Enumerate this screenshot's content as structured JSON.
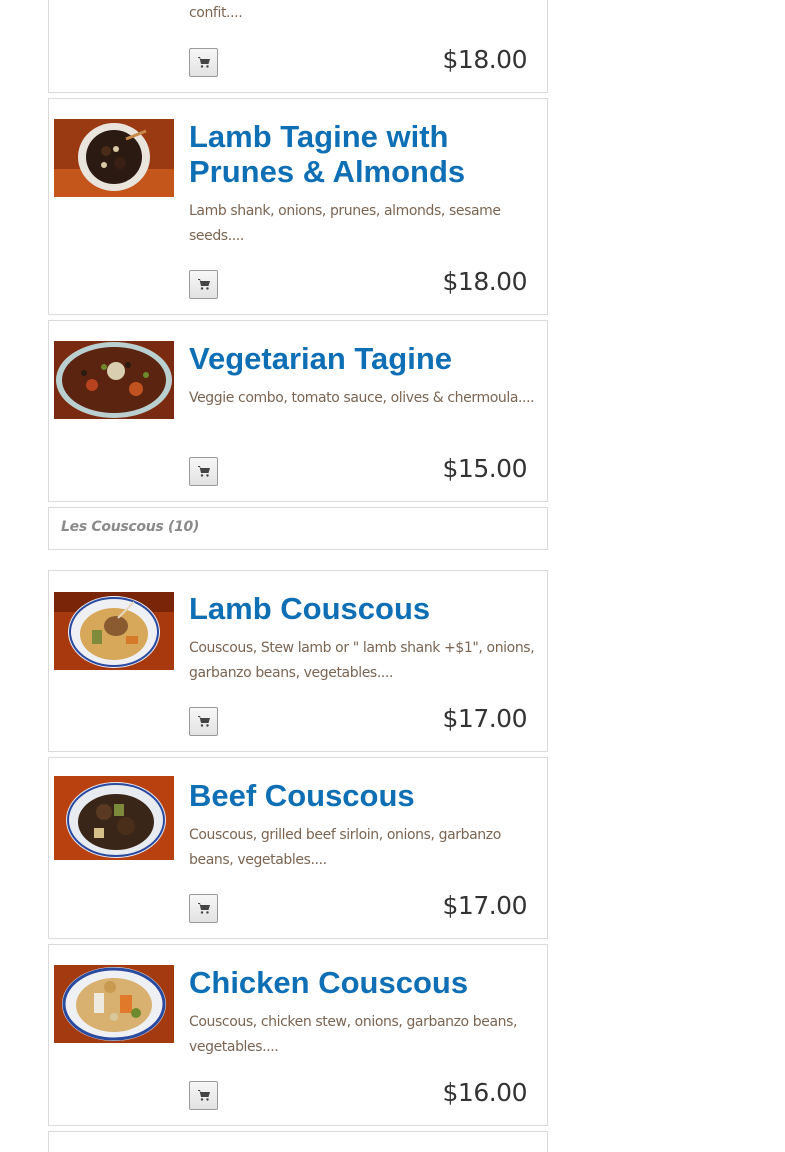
{
  "cart_icon": "shopping-cart-icon",
  "colors": {
    "title": "#0e6fb5",
    "description": "#7b6552",
    "price": "#333333"
  },
  "items": [
    {
      "description_tail": "confit....",
      "price": "$18.00"
    },
    {
      "title": "Lamb Tagine with Prunes & Almonds",
      "description": "Lamb shank, onions, prunes, almonds, sesame seeds....",
      "price": "$18.00"
    },
    {
      "title": "Vegetarian Tagine",
      "description": "Veggie combo, tomato sauce, olives & chermoula....",
      "price": "$15.00"
    }
  ],
  "section": {
    "label": "Les Couscous (10)"
  },
  "couscous": [
    {
      "title": "Lamb Couscous",
      "description": "Couscous, Stew lamb or \" lamb shank +$1\", onions, garbanzo beans, vegetables....",
      "price": "$17.00"
    },
    {
      "title": "Beef Couscous",
      "description": "Couscous, grilled beef sirloin, onions, garbanzo beans, vegetables....",
      "price": "$17.00"
    },
    {
      "title": "Chicken Couscous",
      "description": "Couscous, chicken stew, onions, garbanzo beans, vegetables....",
      "price": "$16.00"
    }
  ]
}
